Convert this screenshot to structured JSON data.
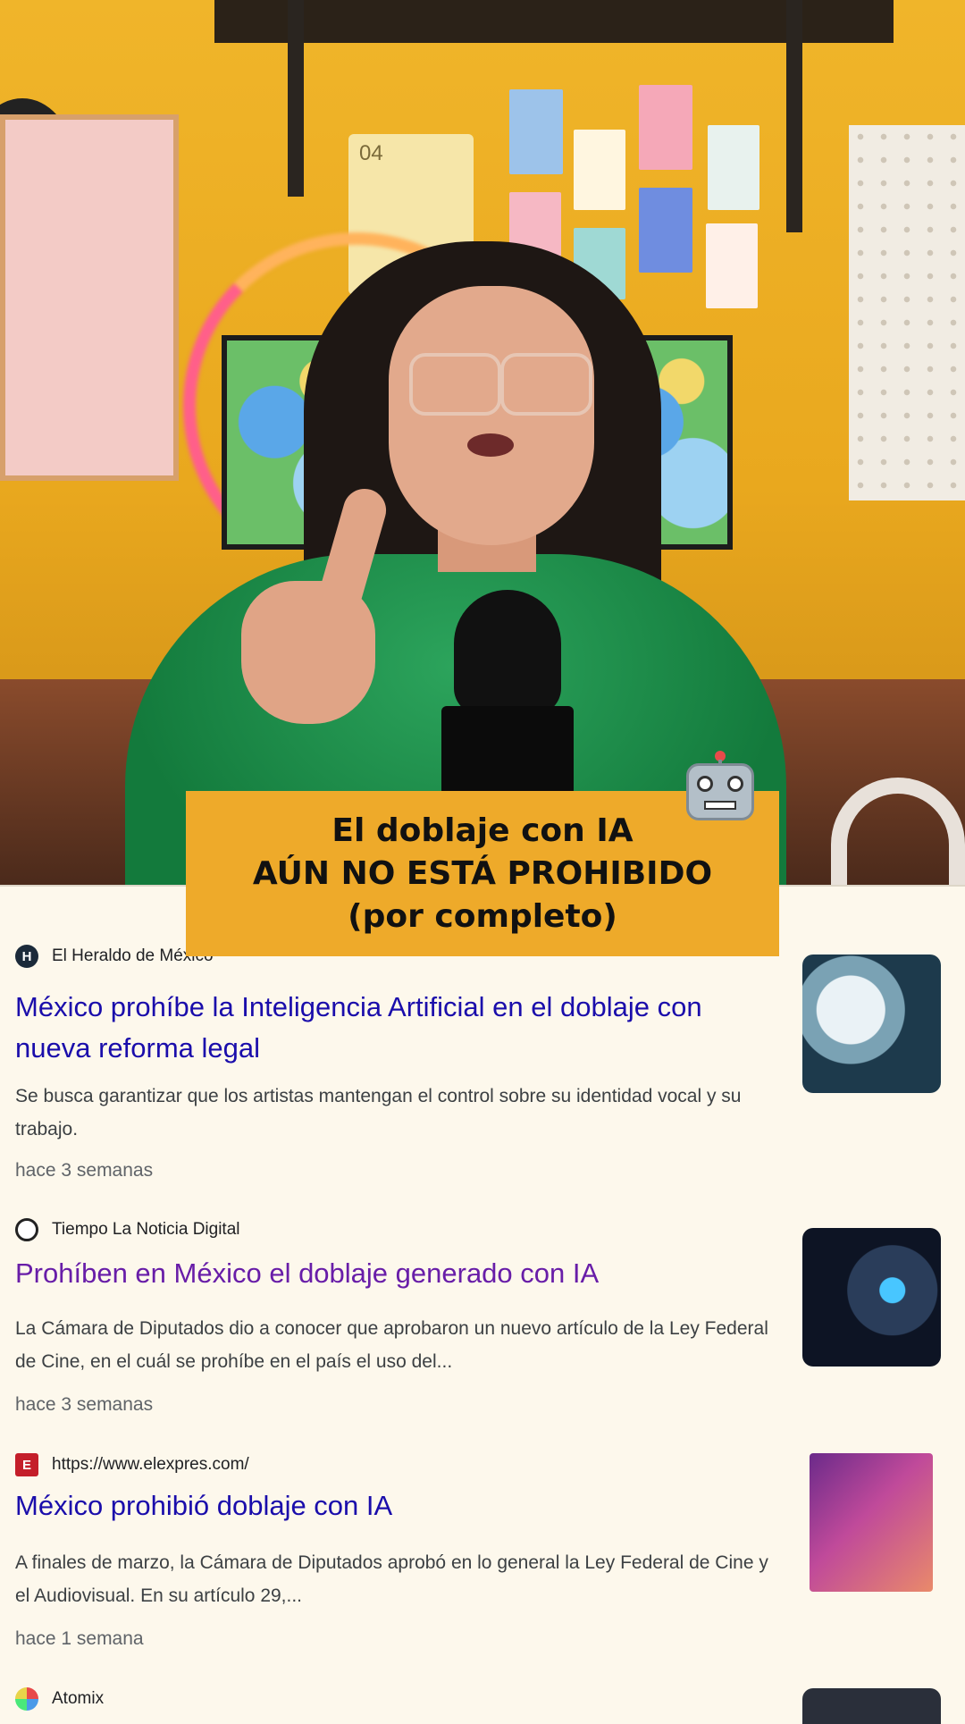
{
  "caption": {
    "line1": "El doblaje con IA",
    "line2": "AÚN NO ESTÁ PROHIBIDO",
    "line3": "(por completo)"
  },
  "scene": {
    "calendar_text": "04",
    "caption_bg": "#eeaa2a"
  },
  "results": [
    {
      "source": "El Heraldo de México",
      "favicon_icon": "heraldo-icon",
      "title": "México prohíbe la Inteligencia Artificial en el doblaje con nueva reforma legal",
      "snippet": "Se busca garantizar que los artistas mantengan el control sobre su identidad vocal y su trabajo.",
      "age": "hace 3 semanas"
    },
    {
      "source": "Tiempo La Noticia Digital",
      "favicon_icon": "tiempo-icon",
      "title": "Prohíben en México el doblaje generado con IA",
      "snippet": "La Cámara de Diputados dio a conocer que aprobaron un nuevo artículo de la Ley Federal de Cine, en el cuál se prohíbe en el país el uso del...",
      "age": "hace 3 semanas"
    },
    {
      "source": "https://www.elexpres.com/",
      "favicon_icon": "elexpres-icon",
      "title": "México prohibió doblaje con IA",
      "snippet": "A finales de marzo, la Cámara de Diputados aprobó en lo general la Ley Federal de Cine y el Audiovisual. En su artículo 29,...",
      "age": "hace 1 semana"
    },
    {
      "source": "Atomix",
      "favicon_icon": "atomix-icon"
    }
  ],
  "colors": {
    "link": "#1a0dab",
    "visited_link": "#681da8"
  }
}
